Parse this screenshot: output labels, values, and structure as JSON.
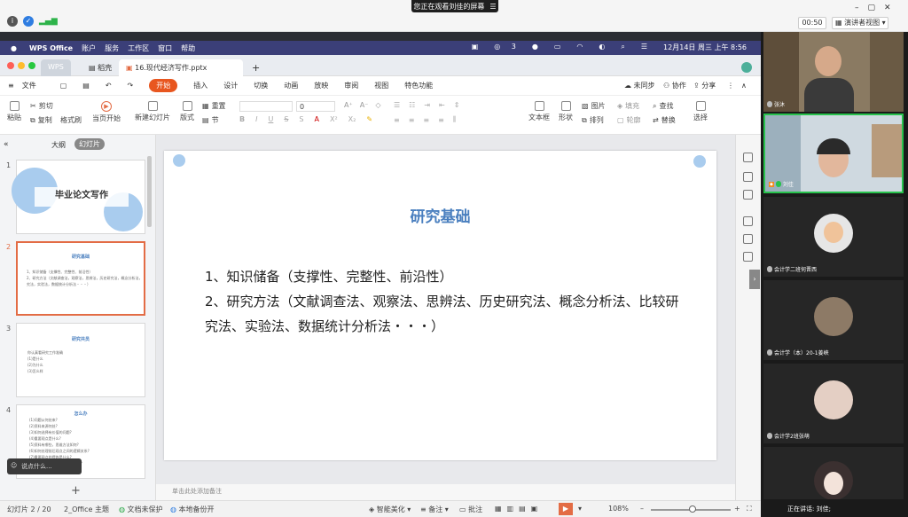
{
  "meeting": {
    "share_banner": "您正在观看刘佳的屏幕",
    "timer": "00:50",
    "view_mode": "演讲者视图"
  },
  "mac_menu": {
    "app": "WPS Office",
    "items": [
      "账户",
      "服务",
      "工作区",
      "窗口",
      "帮助"
    ],
    "wechat_badge": "3",
    "datetime": "12月14日 周三 上午 8:56"
  },
  "wps_tabs": {
    "home": "WPS",
    "template": "稻壳",
    "file": "16.现代经济写作.pptx"
  },
  "menu": {
    "file": "文件",
    "items": [
      "开始",
      "插入",
      "设计",
      "切换",
      "动画",
      "放映",
      "审阅",
      "视图",
      "特色功能"
    ],
    "sync": "未同步",
    "collab": "协作",
    "share": "分享"
  },
  "ribbon": {
    "paste": "粘贴",
    "cut": "剪切",
    "copy": "复制",
    "format": "格式刷",
    "from_start": "当页开始",
    "new_slide": "新建幻灯片",
    "layout": "版式",
    "reset": "重置",
    "section": "节",
    "font_size": "0",
    "textbox": "文本框",
    "shape": "形状",
    "picture": "图片",
    "arrange": "排列",
    "fill": "填充",
    "outline": "轮廓",
    "find": "查找",
    "replace": "替换",
    "select": "选择"
  },
  "panel": {
    "outline_tab": "大纲",
    "slides_tab": "幻灯片",
    "comment_placeholder": "说点什么..."
  },
  "thumbs": [
    {
      "num": "1",
      "title": "毕业论文写作"
    },
    {
      "num": "2",
      "title": "研究基础",
      "lines": [
        "1、知识储备（支撑性、完整性、前沿性）",
        "2、研究方法（文献调查法，观察法，思辨法，历史研究法，概念分析法，比较研",
        "究法，实验法，数据统计分析法・・・）"
      ]
    },
    {
      "num": "3",
      "title": "研究共员",
      "lines": [
        "你认真看研究工作准确",
        "(1)是什么",
        "(2)为什么",
        "(3)怎么样"
      ]
    },
    {
      "num": "4",
      "title": "怎么办",
      "lines": [
        "(1)问题从何处来?",
        "(2)资料来源何处?",
        "(3)如何选择有价值的问题?",
        "(4)重要观点是什么?",
        "(5)资料有哪些，思维方法如何?",
        "(6)如何处理前后观点之间的逻辑关系?",
        "(7)重要观点的提炼是什么?",
        "(8)重要结论和研究价值如何评价?"
      ]
    }
  ],
  "slide": {
    "title": "研究基础",
    "line1": "1、知识储备（支撑性、完整性、前沿性）",
    "line2": "2、研究方法（文献调查法、观察法、思辨法、历史研究法、概念分析法、比较研",
    "line3": "究法、实验法、数据统计分析法・・・）"
  },
  "notes_placeholder": "单击此处添加备注",
  "status": {
    "slide_pos": "幻灯片 2 / 20",
    "theme": "2_Office 主题",
    "protect": "文档未保护",
    "backup": "本地备份开",
    "beautify": "智能美化",
    "notes": "备注",
    "comments": "批注",
    "zoom": "108%"
  },
  "participants": [
    {
      "name": "张沐"
    },
    {
      "name": "刘佳"
    },
    {
      "name": "会计学二班何晋西"
    },
    {
      "name": "会计学（本）20-1姜峡"
    },
    {
      "name": "会计学2班张萌"
    },
    {
      "name": ""
    }
  ],
  "speaking": "正在讲话: 刘佳;"
}
